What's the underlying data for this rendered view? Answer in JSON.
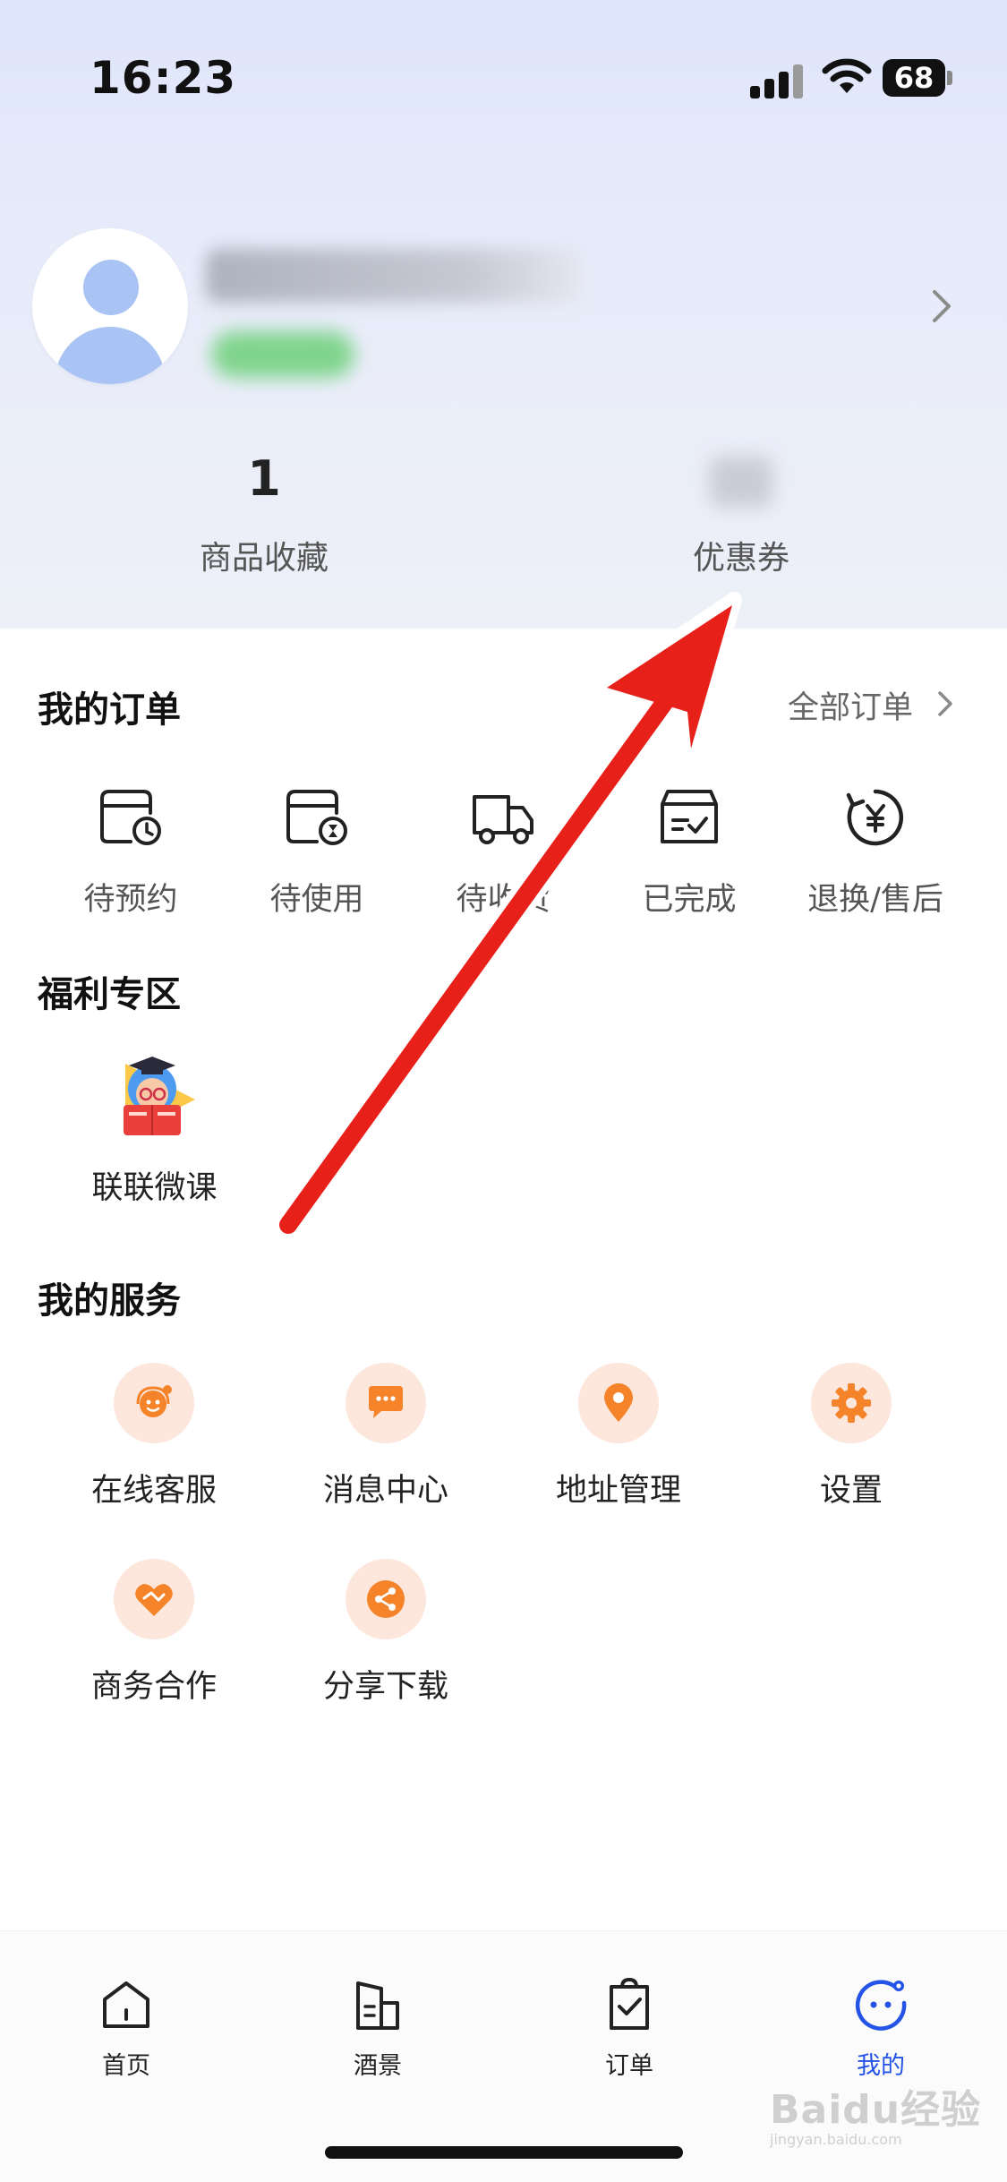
{
  "status_bar": {
    "time": "16:23",
    "battery": "68"
  },
  "profile": {
    "stats": [
      {
        "value": "1",
        "label": "商品收藏"
      },
      {
        "value": "",
        "label": "优惠券"
      }
    ]
  },
  "orders": {
    "title": "我的订单",
    "all_label": "全部订单",
    "items": [
      {
        "label": "待预约",
        "icon": "calendar-clock-icon"
      },
      {
        "label": "待使用",
        "icon": "calendar-hourglass-icon"
      },
      {
        "label": "待收货",
        "icon": "truck-icon"
      },
      {
        "label": "已完成",
        "icon": "box-check-icon"
      },
      {
        "label": "退换/售后",
        "icon": "refund-yuan-icon"
      }
    ]
  },
  "welfare": {
    "title": "福利专区",
    "items": [
      {
        "label": "联联微课",
        "icon": "graduate-mascot-icon"
      }
    ]
  },
  "services": {
    "title": "我的服务",
    "items": [
      {
        "label": "在线客服",
        "icon": "headset-agent-icon"
      },
      {
        "label": "消息中心",
        "icon": "chat-bubble-icon"
      },
      {
        "label": "地址管理",
        "icon": "location-pin-icon"
      },
      {
        "label": "设置",
        "icon": "gear-icon"
      },
      {
        "label": "商务合作",
        "icon": "handshake-heart-icon"
      },
      {
        "label": "分享下载",
        "icon": "share-icon"
      }
    ]
  },
  "tab_bar": {
    "tabs": [
      {
        "label": "首页",
        "icon": "home-icon"
      },
      {
        "label": "酒景",
        "icon": "hotel-building-icon"
      },
      {
        "label": "订单",
        "icon": "clipboard-check-icon"
      },
      {
        "label": "我的",
        "icon": "smiley-face-icon",
        "active": true
      }
    ]
  },
  "watermark": {
    "text": "Baidu经验",
    "sub": "jingyan.baidu.com"
  },
  "colors": {
    "accent_orange": "#f5832a",
    "service_circle_bg": "#fde6dc",
    "active_tab": "#2453e8",
    "arrow_red": "#e8201a",
    "header_gradient_top": "#dfe5fb"
  }
}
